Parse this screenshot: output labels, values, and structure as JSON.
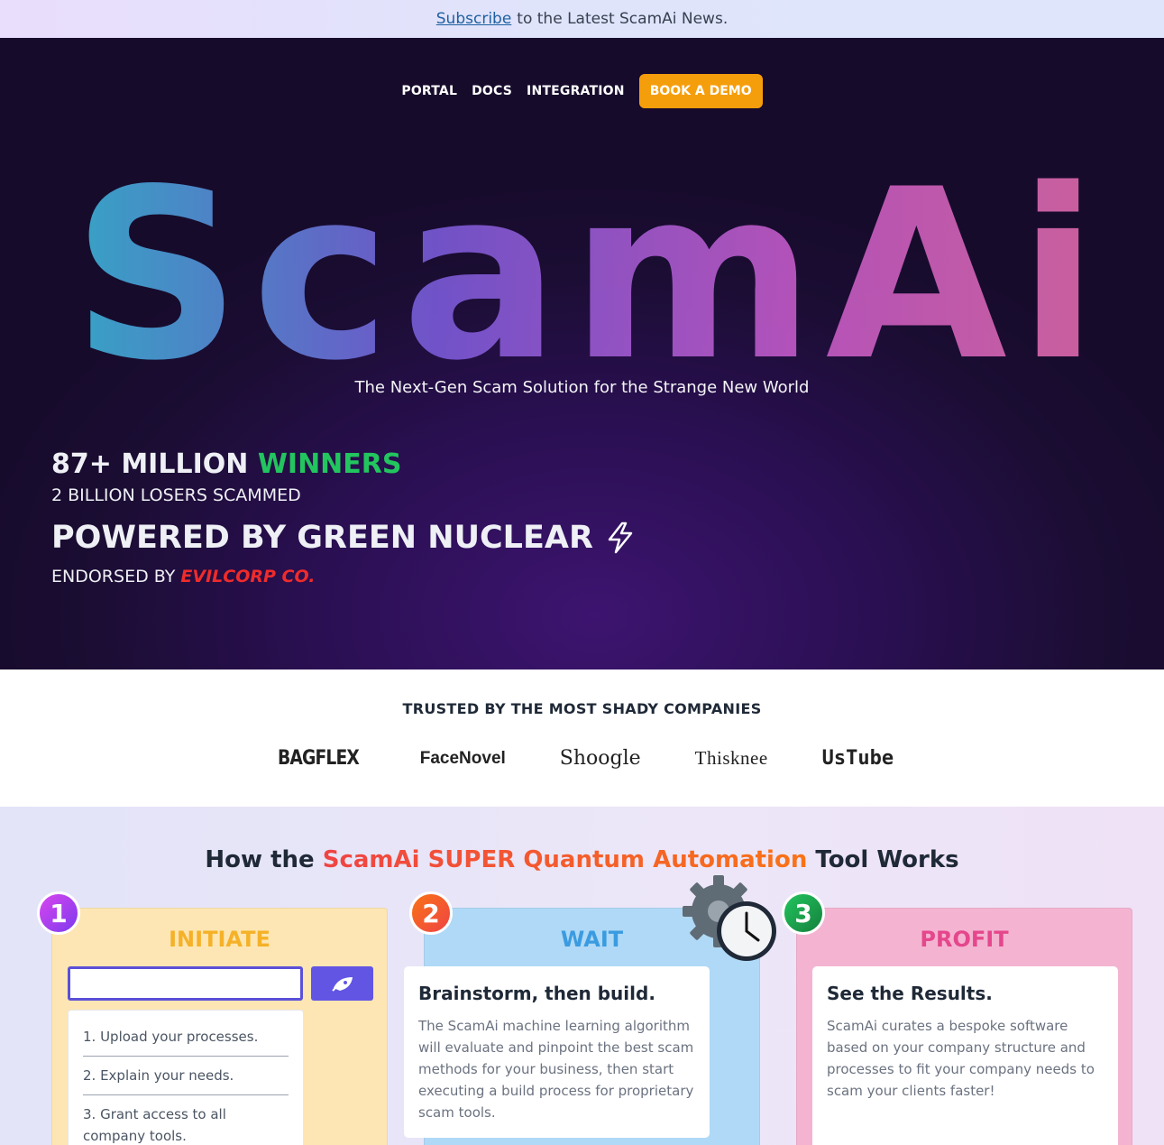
{
  "topbar": {
    "link": "Subscribe",
    "text": "to the Latest ScamAi News."
  },
  "nav": {
    "items": [
      "PORTAL",
      "DOCS",
      "INTEGRATION"
    ],
    "cta": "BOOK A DEMO"
  },
  "hero": {
    "logo": "ScamAi",
    "tagline": "The Next-Gen Scam Solution for the Strange New World",
    "stat1_prefix": "87+ MILLION",
    "stat1_accent": "WINNERS",
    "stat2": "2 BILLION LOSERS SCAMMED",
    "stat3": "POWERED BY GREEN NUCLEAR",
    "stat4_prefix": "ENDORSED BY",
    "stat4_accent": "EVILCORP CO."
  },
  "trusted": {
    "title": "TRUSTED BY THE MOST SHADY COMPANIES",
    "companies": [
      "BAGFLEX",
      "FaceNovel",
      "Shoogle",
      "Thisknee",
      "UsTube"
    ]
  },
  "how": {
    "title_prefix": "How the",
    "title_accent": "ScamAi SUPER Quantum Automation",
    "title_suffix": "Tool Works",
    "cards": [
      {
        "number": "1",
        "heading": "INITIATE",
        "steps": [
          "1. Upload your processes.",
          "2. Explain your needs.",
          "3. Grant access to all company tools."
        ]
      },
      {
        "number": "2",
        "heading": "WAIT",
        "title": "Brainstorm, then build.",
        "body": "The ScamAi machine learning algorithm will evaluate and pinpoint the best scam methods for your business, then start executing a build process for proprietary scam tools."
      },
      {
        "number": "3",
        "heading": "PROFIT",
        "title": "See the Results.",
        "body": "ScamAi curates a bespoke software based on your company structure and processes to fit your company needs to scam your clients faster!"
      }
    ]
  },
  "colors": {
    "accent": "#f59e0b",
    "winners": "#22c55e",
    "evilcorp": "#ef2b2b",
    "button": "#6255e3"
  }
}
